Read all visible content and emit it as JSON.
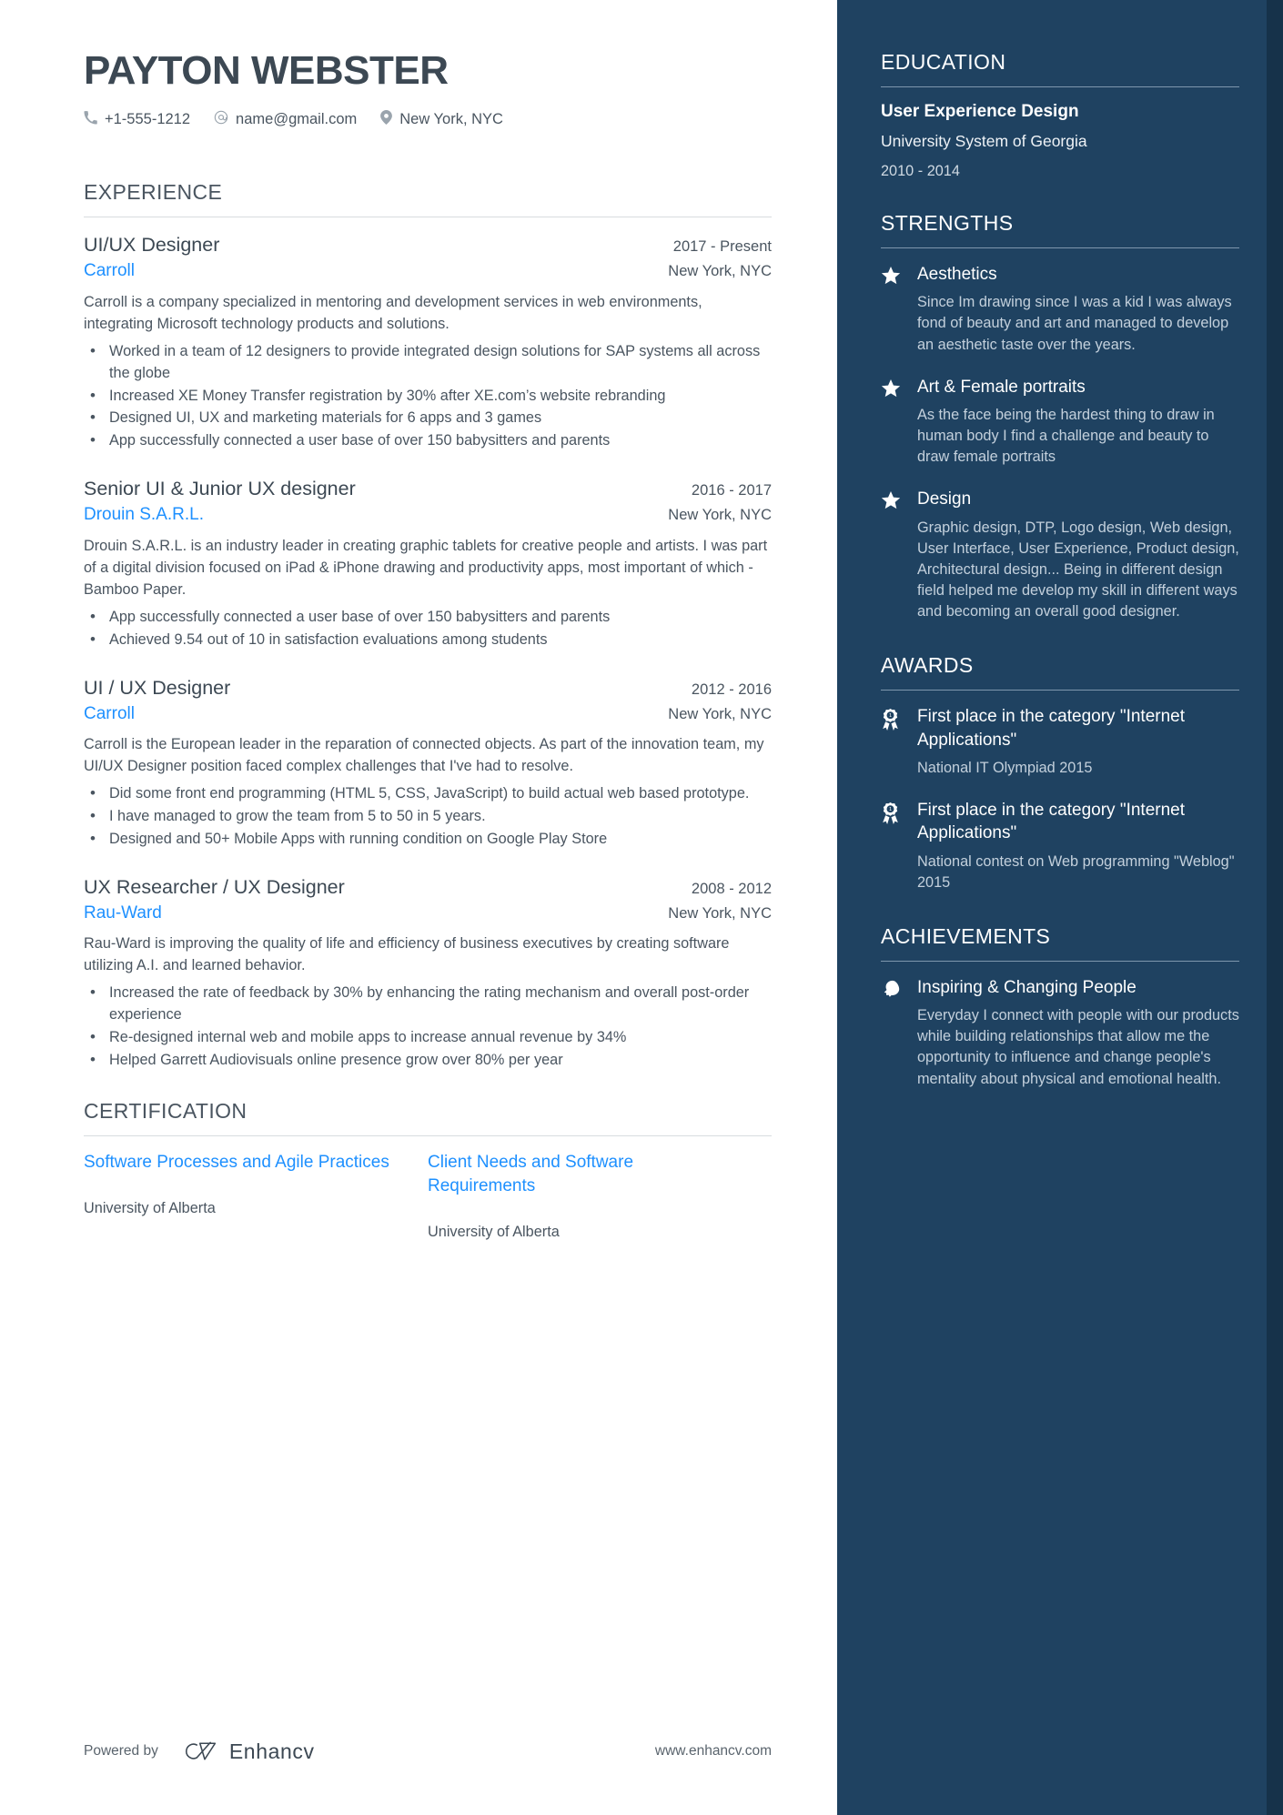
{
  "header": {
    "name": "PAYTON WEBSTER",
    "contacts": [
      {
        "icon": "phone-icon",
        "text": "+1-555-1212"
      },
      {
        "icon": "email-icon",
        "text": "name@gmail.com"
      },
      {
        "icon": "location-pin-icon",
        "text": "New York, NYC"
      }
    ]
  },
  "experience": {
    "title": "EXPERIENCE",
    "jobs": [
      {
        "title": "UI/UX Designer",
        "date": "2017 - Present",
        "company": "Carroll",
        "location": "New York, NYC",
        "description": "Carroll is a company specialized  in mentoring   and  development  services  in web environments,      integrating Microsoft technology products and  solutions.",
        "bullets": [
          "Worked in a team of 12 designers to provide integrated design solutions for SAP systems all across the globe",
          "Increased XE Money Transfer registration by 30% after XE.com’s website rebranding",
          "Designed UI, UX and marketing materials for 6 apps and 3 games",
          "App successfully connected a user base of over 150 babysitters and parents"
        ]
      },
      {
        "title": "Senior UI & Junior UX designer",
        "date": "2016 - 2017",
        "company": "Drouin S.A.R.L.",
        "location": "New York, NYC",
        "description": "Drouin S.A.R.L. is an industry leader in creating graphic tablets for creative people and artists. I was part of a digital division focused on iPad & iPhone drawing and productivity apps, most important of which - Bamboo Paper.",
        "bullets": [
          "App successfully connected a user base of over 150 babysitters and parents",
          "Achieved 9.54 out of 10 in satisfaction evaluations among students"
        ]
      },
      {
        "title": "UI / UX Designer",
        "date": "2012 - 2016",
        "company": "Carroll",
        "location": "New York, NYC",
        "description": "Carroll is the European leader in the reparation of connected objects. As part of the innovation team, my UI/UX Designer position faced complex challenges that I've had to resolve.",
        "bullets": [
          "Did some front end programming (HTML 5, CSS, JavaScript) to build actual web based prototype.",
          "I have managed to grow the team from 5 to 50 in 5 years.",
          "Designed and 50+ Mobile Apps with running condition on Google Play Store"
        ]
      },
      {
        "title": "UX Researcher / UX Designer",
        "date": "2008 - 2012",
        "company": "Rau-Ward",
        "location": "New York, NYC",
        "description": "Rau-Ward is improving the quality of life and efficiency of business executives by creating software utilizing A.I. and learned behavior.",
        "bullets": [
          "Increased the rate of feedback by 30% by enhancing the rating mechanism and overall post-order experience",
          "Re-designed internal web and mobile apps to increase annual revenue by 34%",
          "Helped Garrett Audiovisuals online presence grow over 80% per year"
        ]
      }
    ]
  },
  "certification": {
    "title": "CERTIFICATION",
    "items": [
      {
        "name": "Software Processes and Agile Practices",
        "org": "University of Alberta"
      },
      {
        "name": "Client Needs and Software Requirements",
        "org": "University of Alberta"
      }
    ]
  },
  "education": {
    "title": "EDUCATION",
    "degree": "User Experience Design",
    "school": "University System of Georgia",
    "date": "2010 - 2014"
  },
  "strengths": {
    "title": "STRENGTHS",
    "items": [
      {
        "name": "Aesthetics",
        "desc": "Since Im drawing since I was a kid I was always fond of beauty and art and managed to develop an aesthetic taste over the years."
      },
      {
        "name": "Art & Female portraits",
        "desc": "As the face being the hardest thing to draw in human body I find a challenge and beauty to draw female portraits"
      },
      {
        "name": "Design",
        "desc": "Graphic design, DTP, Logo design, Web design, User Interface, User Experience, Product design, Architectural design... Being in different design field helped me develop my skill in different ways and becoming an overall good designer."
      }
    ]
  },
  "awards": {
    "title": "AWARDS",
    "items": [
      {
        "name": "First place in the category \"Internet Applications\"",
        "sub": "National IT Olympiad 2015"
      },
      {
        "name": "First place in the category \"Internet Applications\"",
        "sub": "National contest on Web programming \"Weblog\" 2015"
      }
    ]
  },
  "achievements": {
    "title": "ACHIEVEMENTS",
    "items": [
      {
        "name": "Inspiring & Changing People",
        "desc": "Everyday I connect with people with our products while building relationships that allow me the opportunity to influence and change people's mentality about physical and emotional health."
      }
    ]
  },
  "footer": {
    "powered_by": "Powered by",
    "brand": "Enhancv",
    "website": "www.enhancv.com"
  },
  "colors": {
    "accent_link": "#1e90ff",
    "sidebar_bg": "#1f4261",
    "sidebar_edge": "#16324a",
    "heading": "#3c4853"
  }
}
